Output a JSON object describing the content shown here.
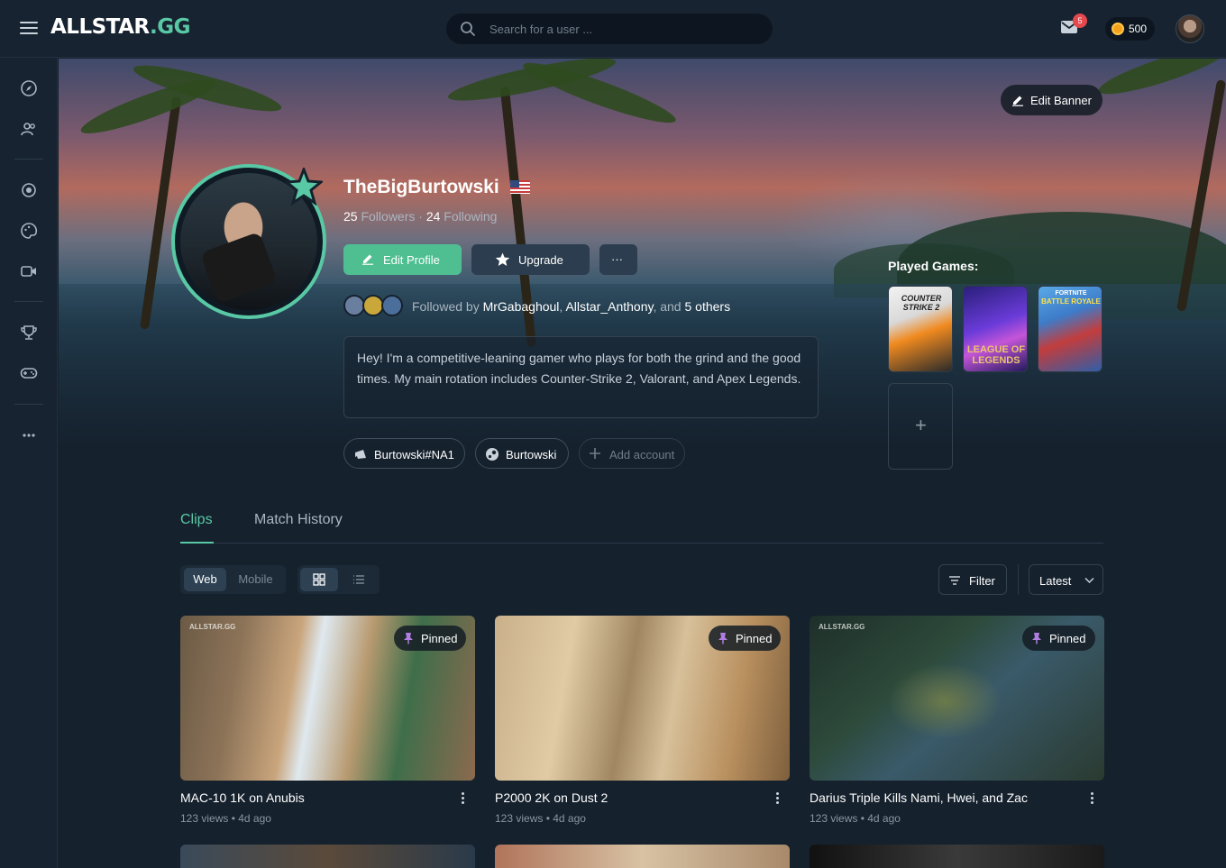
{
  "header": {
    "logo_main": "ALLSTAR",
    "logo_tld": ".GG",
    "search_placeholder": "Search for a user ...",
    "mail_badge": "5",
    "coins": "500"
  },
  "banner": {
    "edit_banner_label": "Edit Banner"
  },
  "profile": {
    "username": "TheBigBurtowski",
    "followers_count": "25",
    "followers_label": "Followers",
    "separator": "·",
    "following_count": "24",
    "following_label": "Following",
    "edit_profile_label": "Edit Profile",
    "upgrade_label": "Upgrade",
    "more_label": "···",
    "followed_by_prefix": "Followed by",
    "followed_by_user1": "MrGabaghoul",
    "followed_by_comma": ",",
    "followed_by_user2": "Allstar_Anthony",
    "followed_by_and": ", and",
    "followed_by_others": "5 others",
    "bio": "Hey! I'm a competitive-leaning gamer who plays for both the grind and the good times. My main rotation includes Counter-Strike 2, Valorant, and Apex Legends.",
    "accounts": [
      {
        "label": "Burtowski#NA1",
        "icon": "riot-icon"
      },
      {
        "label": "Burtowski",
        "icon": "steam-icon"
      }
    ],
    "add_account_label": "Add account"
  },
  "played_games": {
    "title": "Played Games:",
    "games": [
      {
        "name": "COUNTER STRIKE 2",
        "line1": "COUNTER",
        "line2": "STRIKE 2"
      },
      {
        "name": "LEAGUE OF LEGENDS",
        "line1": "LEAGUE OF",
        "line2": "LEGENDS"
      },
      {
        "name": "FORTNITE BATTLE ROYALE",
        "line1": "FORTNITE",
        "line2": "BATTLE ROYALE"
      }
    ],
    "add_label": "+"
  },
  "tabs": [
    {
      "label": "Clips",
      "active": true
    },
    {
      "label": "Match History",
      "active": false
    }
  ],
  "toolbar": {
    "platform": [
      {
        "label": "Web",
        "active": true
      },
      {
        "label": "Mobile",
        "active": false
      }
    ],
    "view": [
      {
        "icon": "grid-icon",
        "active": true
      },
      {
        "icon": "list-icon",
        "active": false
      }
    ],
    "filter_label": "Filter",
    "sort_label": "Latest"
  },
  "clips": [
    {
      "title": "MAC-10 1K on Anubis",
      "meta": "123 views • 4d ago",
      "pinned_label": "Pinned",
      "watermark": "ALLSTAR.GG"
    },
    {
      "title": "P2000 2K on Dust 2",
      "meta": "123 views • 4d ago",
      "pinned_label": "Pinned",
      "watermark": ""
    },
    {
      "title": "Darius Triple Kills Nami, Hwei, and Zac",
      "meta": "123 views • 4d ago",
      "pinned_label": "Pinned",
      "watermark": "ALLSTAR.GG"
    }
  ],
  "colors": {
    "accent": "#59c9a5",
    "background": "#15212d",
    "panel": "#172331",
    "badge": "#e5484d",
    "coin": "#f3a11c"
  }
}
